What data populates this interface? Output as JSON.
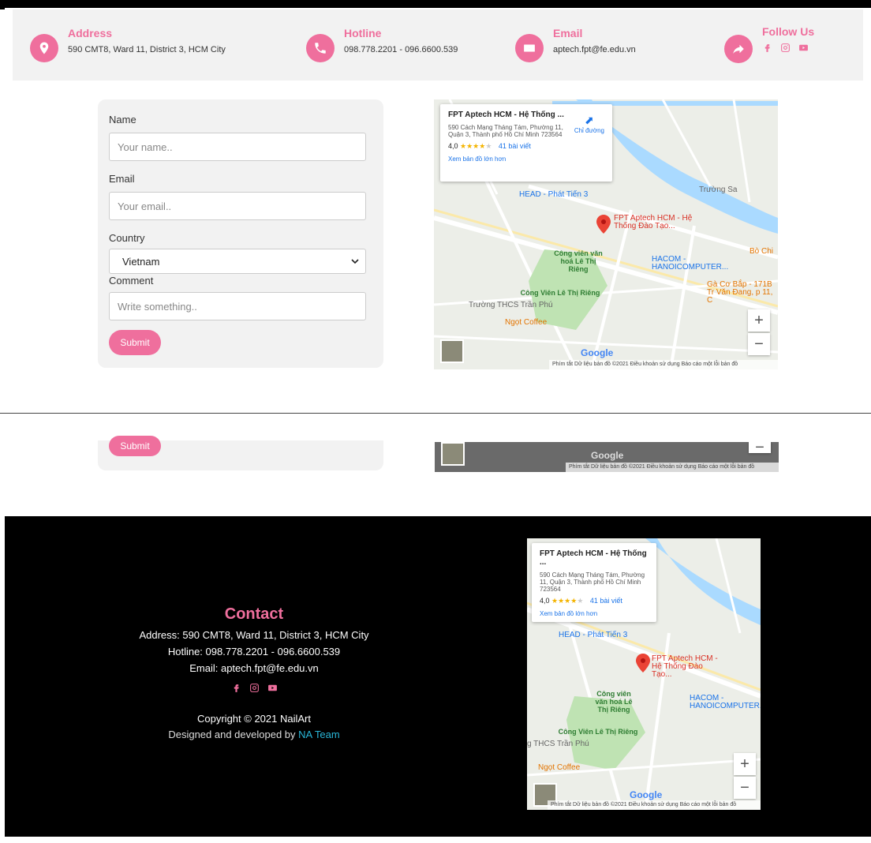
{
  "info": {
    "address": {
      "title": "Address",
      "text": "590 CMT8, Ward 11, District 3, HCM City"
    },
    "hotline": {
      "title": "Hotline",
      "text": "098.778.2201 - 096.6600.539"
    },
    "email": {
      "title": "Email",
      "text": "aptech.fpt@fe.edu.vn"
    },
    "follow": {
      "title": "Follow Us"
    }
  },
  "form": {
    "name_label": "Name",
    "name_placeholder": "Your name..",
    "email_label": "Email",
    "email_placeholder": "Your email..",
    "country_label": "Country",
    "country_value": "Vietnam",
    "comment_label": "Comment",
    "comment_placeholder": "Write something..",
    "submit_label": "Submit"
  },
  "map": {
    "place_title": "FPT Aptech HCM - Hệ Thống ...",
    "place_address": "590 Cách Mạng Tháng Tám, Phường 11, Quận 3, Thành phố Hồ Chí Minh 723564",
    "rating": "4,0",
    "stars": "★★★★",
    "star_empty": "★",
    "reviews": "41 bài viết",
    "larger_map": "Xem bản đồ lớn hơn",
    "directions": "Chỉ đường",
    "pin_label": "FPT Aptech HCM - Hệ Thống Đào Tạo...",
    "head_label": "HEAD - Phát Tiến 3",
    "hacom_label": "HACOM - HANOICOMPUTER...",
    "park_label": "Công viên văn hoá Lê Thị Riêng",
    "park_label2": "Công Viên Lê Thị Riêng",
    "school_label": "Trường THCS Trần Phú",
    "school_label_short": "g THCS Trần Phú",
    "coffee_label": "Ngọt Coffee",
    "truong_sa": "Trường Sa",
    "gacobap": "Gà Cơ Bắp - 171B Tr Văn Đang, p 11, C",
    "bo_chi": "Bò Chi",
    "google": "Google",
    "footer_text": "Phím tắt   Dữ liệu bản đồ ©2021   Điều khoản sử dụng   Báo cáo một lỗi bản đồ",
    "zoom_in": "+",
    "zoom_out": "−"
  },
  "footer": {
    "title": "Contact",
    "address_line": "Address: 590 CMT8, Ward 11, District 3, HCM City",
    "hotline_line": "Hotline: 098.778.2201 - 096.6600.539",
    "email_line": "Email: aptech.fpt@fe.edu.vn",
    "copyright": "Copyright © 2021 NailArt",
    "designed_prefix": "Designed and developed by ",
    "team": "NA Team"
  },
  "colors": {
    "accent": "#ef6f9d",
    "team_link": "#29b6d8"
  }
}
